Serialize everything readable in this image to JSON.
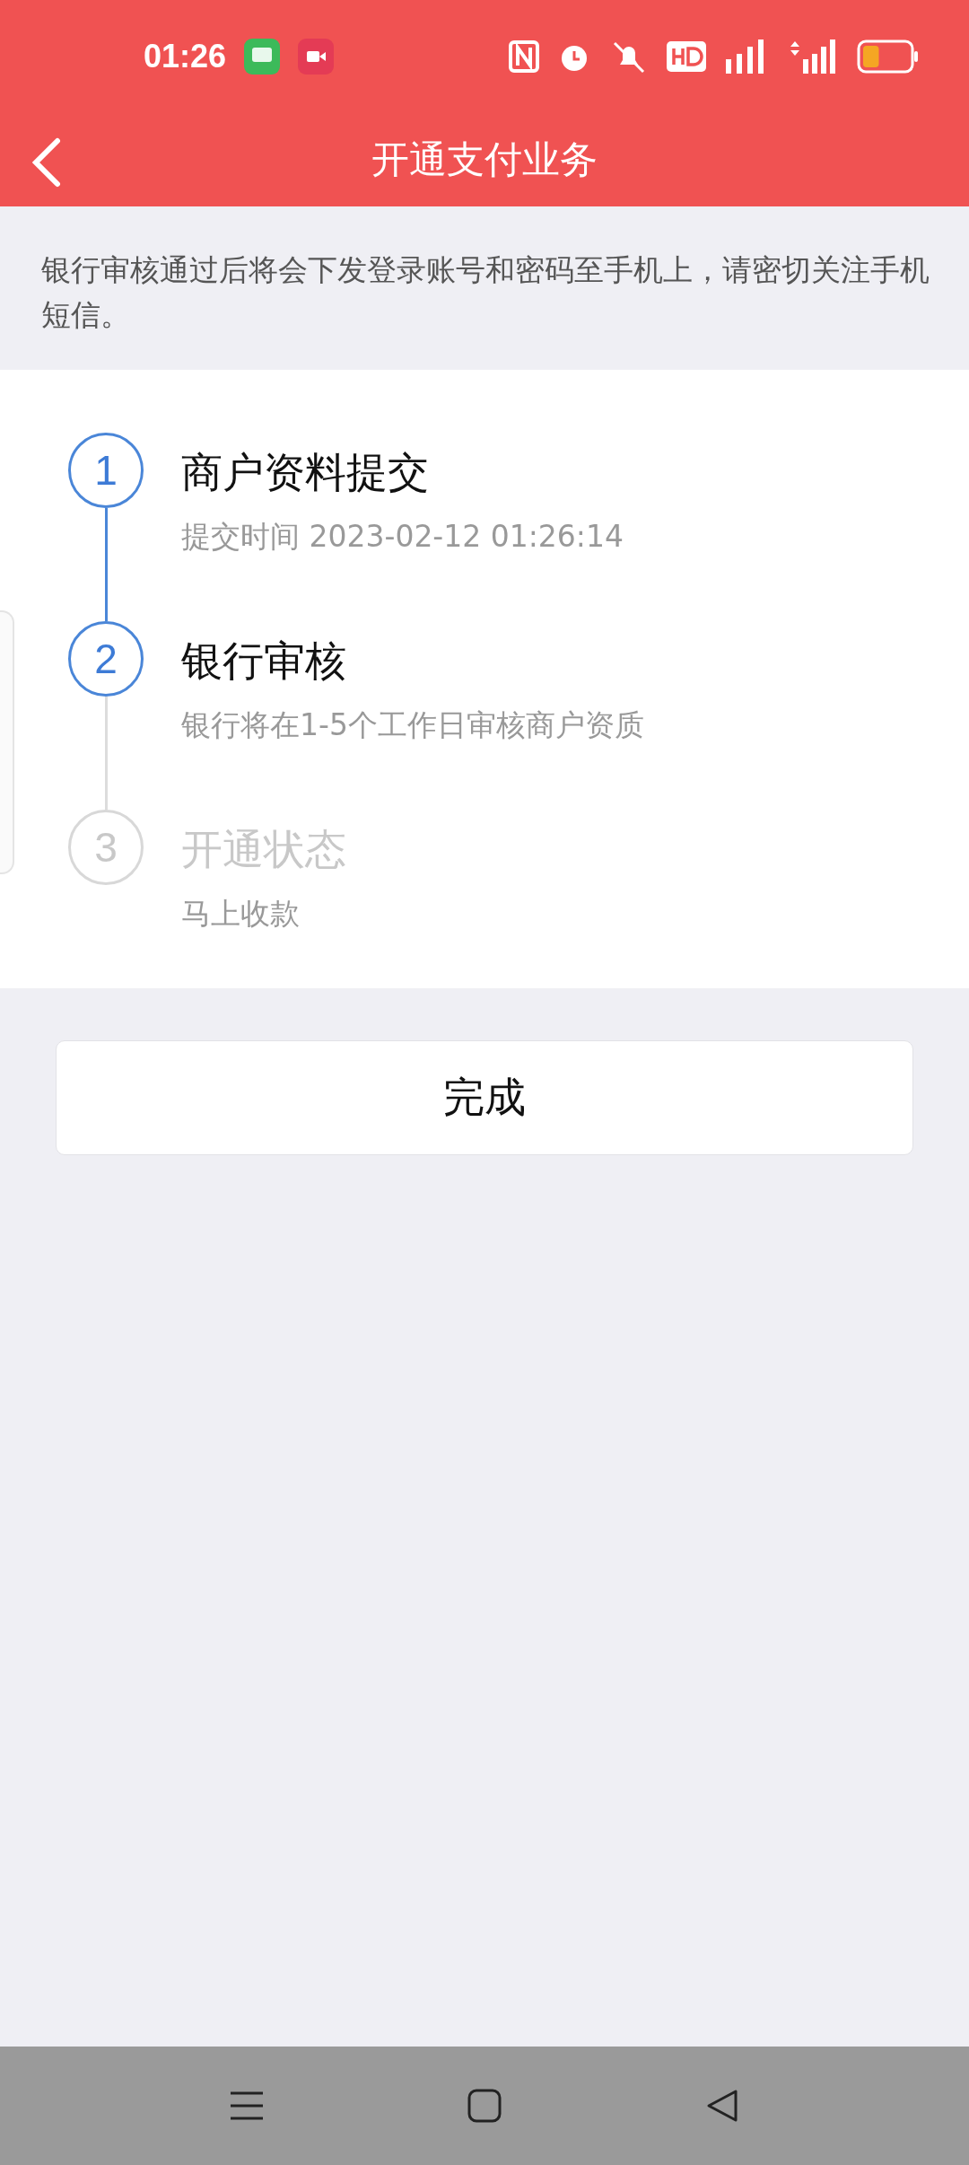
{
  "status_bar": {
    "time": "01:26",
    "battery": {
      "level": 0.35
    }
  },
  "header": {
    "title": "开通支付业务"
  },
  "notice": "银行审核通过后将会下发登录账号和密码至手机上，请密切关注手机短信。",
  "steps": [
    {
      "number": "1",
      "title": "商户资料提交",
      "subtitle": "提交时间 2023-02-12 01:26:14",
      "active": true
    },
    {
      "number": "2",
      "title": "银行审核",
      "subtitle": "银行将在1-5个工作日审核商户资质",
      "active": true
    },
    {
      "number": "3",
      "title": "开通状态",
      "subtitle": "马上收款",
      "active": false
    }
  ],
  "done_button": "完成"
}
